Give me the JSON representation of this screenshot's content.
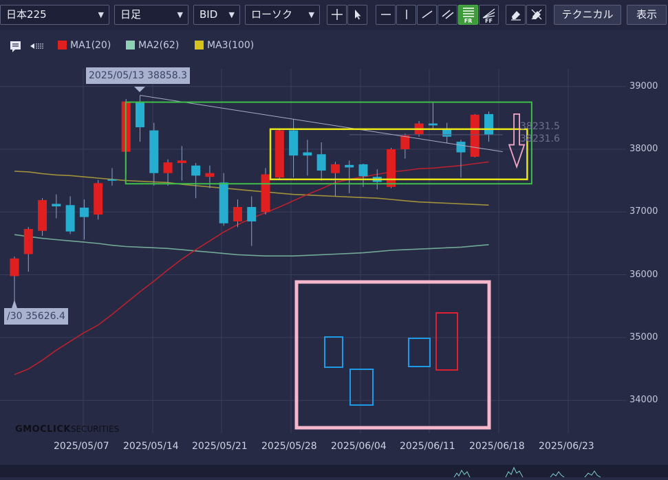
{
  "toolbar": {
    "symbol": "日本225",
    "period": "日足",
    "price_type": "BID",
    "chart_style": "ローソク",
    "technical_label": "テクニカル",
    "display_label": "表示",
    "fr_label": "FR",
    "ff_label": "FF"
  },
  "legend": [
    {
      "label": "MA1(20)",
      "color": "#e02020"
    },
    {
      "label": "MA2(62)",
      "color": "#8fd1b4"
    },
    {
      "label": "MA3(100)",
      "color": "#d6c21c"
    }
  ],
  "y_axis_labels": [
    "39000",
    "38000",
    "37000",
    "36000",
    "35000",
    "34000"
  ],
  "x_axis_labels": [
    "2025/05/07",
    "2025/05/14",
    "2025/05/21",
    "2025/05/28",
    "2025/06/04",
    "2025/06/11",
    "2025/06/18",
    "2025/06/23"
  ],
  "callouts": {
    "high": "2025/05/13 38858.3",
    "low": "/30 35626.4"
  },
  "price_tags": [
    "38231.5",
    "38231.6"
  ],
  "logo": {
    "main": "GMOCLICK",
    "sub": "SECURITIES"
  },
  "chart_data": {
    "type": "candlestick",
    "instrument": "日本225",
    "period": "日足",
    "ylim": [
      33600,
      39400
    ],
    "colors": {
      "up": "#e02020",
      "down": "#25aed0"
    },
    "candles": [
      {
        "o": 35980,
        "h": 36290,
        "l": 35620,
        "c": 36260
      },
      {
        "o": 36330,
        "h": 36760,
        "l": 36050,
        "c": 36730
      },
      {
        "o": 36700,
        "h": 37220,
        "l": 36620,
        "c": 37190
      },
      {
        "o": 37130,
        "h": 37280,
        "l": 36900,
        "c": 37090
      },
      {
        "o": 37110,
        "h": 37250,
        "l": 36650,
        "c": 36690
      },
      {
        "o": 37070,
        "h": 37200,
        "l": 36560,
        "c": 36920
      },
      {
        "o": 36960,
        "h": 37510,
        "l": 36880,
        "c": 37460
      },
      {
        "o": 37520,
        "h": 37700,
        "l": 37420,
        "c": 37500
      },
      {
        "o": 37960,
        "h": 38800,
        "l": 37600,
        "c": 38760
      },
      {
        "o": 38760,
        "h": 38858,
        "l": 38120,
        "c": 38350
      },
      {
        "o": 38300,
        "h": 38420,
        "l": 37420,
        "c": 37620
      },
      {
        "o": 37620,
        "h": 37840,
        "l": 37420,
        "c": 37790
      },
      {
        "o": 37780,
        "h": 38050,
        "l": 37500,
        "c": 37820
      },
      {
        "o": 37740,
        "h": 37780,
        "l": 37220,
        "c": 37580
      },
      {
        "o": 37560,
        "h": 37740,
        "l": 37380,
        "c": 37620
      },
      {
        "o": 37470,
        "h": 37620,
        "l": 36780,
        "c": 36820
      },
      {
        "o": 36850,
        "h": 37200,
        "l": 36760,
        "c": 37080
      },
      {
        "o": 37080,
        "h": 37250,
        "l": 36460,
        "c": 36850
      },
      {
        "o": 37000,
        "h": 37700,
        "l": 36960,
        "c": 37600
      },
      {
        "o": 37550,
        "h": 38330,
        "l": 37520,
        "c": 38300
      },
      {
        "o": 38300,
        "h": 38480,
        "l": 37550,
        "c": 37900
      },
      {
        "o": 37950,
        "h": 38150,
        "l": 37580,
        "c": 37900
      },
      {
        "o": 37920,
        "h": 38110,
        "l": 37500,
        "c": 37660
      },
      {
        "o": 37620,
        "h": 37800,
        "l": 37250,
        "c": 37760
      },
      {
        "o": 37750,
        "h": 37820,
        "l": 37300,
        "c": 37710
      },
      {
        "o": 37760,
        "h": 37770,
        "l": 37400,
        "c": 37570
      },
      {
        "o": 37560,
        "h": 37680,
        "l": 37360,
        "c": 37480
      },
      {
        "o": 37400,
        "h": 38020,
        "l": 37380,
        "c": 38000
      },
      {
        "o": 38000,
        "h": 38250,
        "l": 37850,
        "c": 38220
      },
      {
        "o": 38240,
        "h": 38450,
        "l": 38200,
        "c": 38410
      },
      {
        "o": 38410,
        "h": 38750,
        "l": 38330,
        "c": 38380
      },
      {
        "o": 38330,
        "h": 38420,
        "l": 38100,
        "c": 38200
      },
      {
        "o": 38120,
        "h": 38150,
        "l": 37550,
        "c": 37950
      },
      {
        "o": 37880,
        "h": 38560,
        "l": 37870,
        "c": 38550
      },
      {
        "o": 38560,
        "h": 38600,
        "l": 38120,
        "c": 38230
      }
    ],
    "ma1": [
      34410,
      34500,
      34640,
      34800,
      34940,
      35080,
      35200,
      35370,
      35550,
      35730,
      35900,
      36080,
      36250,
      36400,
      36540,
      36680,
      36800,
      36900,
      36990,
      37080,
      37180,
      37280,
      37370,
      37470,
      37520,
      37560,
      37600,
      37640,
      37660,
      37690,
      37700,
      37720,
      37740,
      37770,
      37800
    ],
    "ma2": [
      36640,
      36610,
      36580,
      36560,
      36540,
      36520,
      36500,
      36470,
      36450,
      36440,
      36430,
      36420,
      36400,
      36380,
      36360,
      36340,
      36320,
      36310,
      36300,
      36300,
      36300,
      36310,
      36320,
      36330,
      36340,
      36350,
      36370,
      36390,
      36400,
      36410,
      36420,
      36430,
      36440,
      36460,
      36480
    ],
    "ma3": [
      37650,
      37640,
      37610,
      37590,
      37580,
      37560,
      37540,
      37520,
      37500,
      37490,
      37480,
      37470,
      37440,
      37420,
      37400,
      37380,
      37360,
      37340,
      37320,
      37300,
      37280,
      37270,
      37260,
      37250,
      37240,
      37230,
      37220,
      37200,
      37180,
      37160,
      37150,
      37140,
      37130,
      37120,
      37110
    ],
    "trendline": {
      "from": [
        9,
        38858
      ],
      "to": [
        35,
        37960
      ]
    },
    "hline_level": 38231,
    "annotations": {
      "green_box": {
        "from": 8,
        "to": 37,
        "top": 38750,
        "bottom": 37450
      },
      "yellow_box": {
        "from": 18,
        "to": 37,
        "top": 38320,
        "bottom": 37520
      },
      "arrow": {
        "at": 36,
        "top": 38560,
        "bottom": 37720
      }
    }
  }
}
